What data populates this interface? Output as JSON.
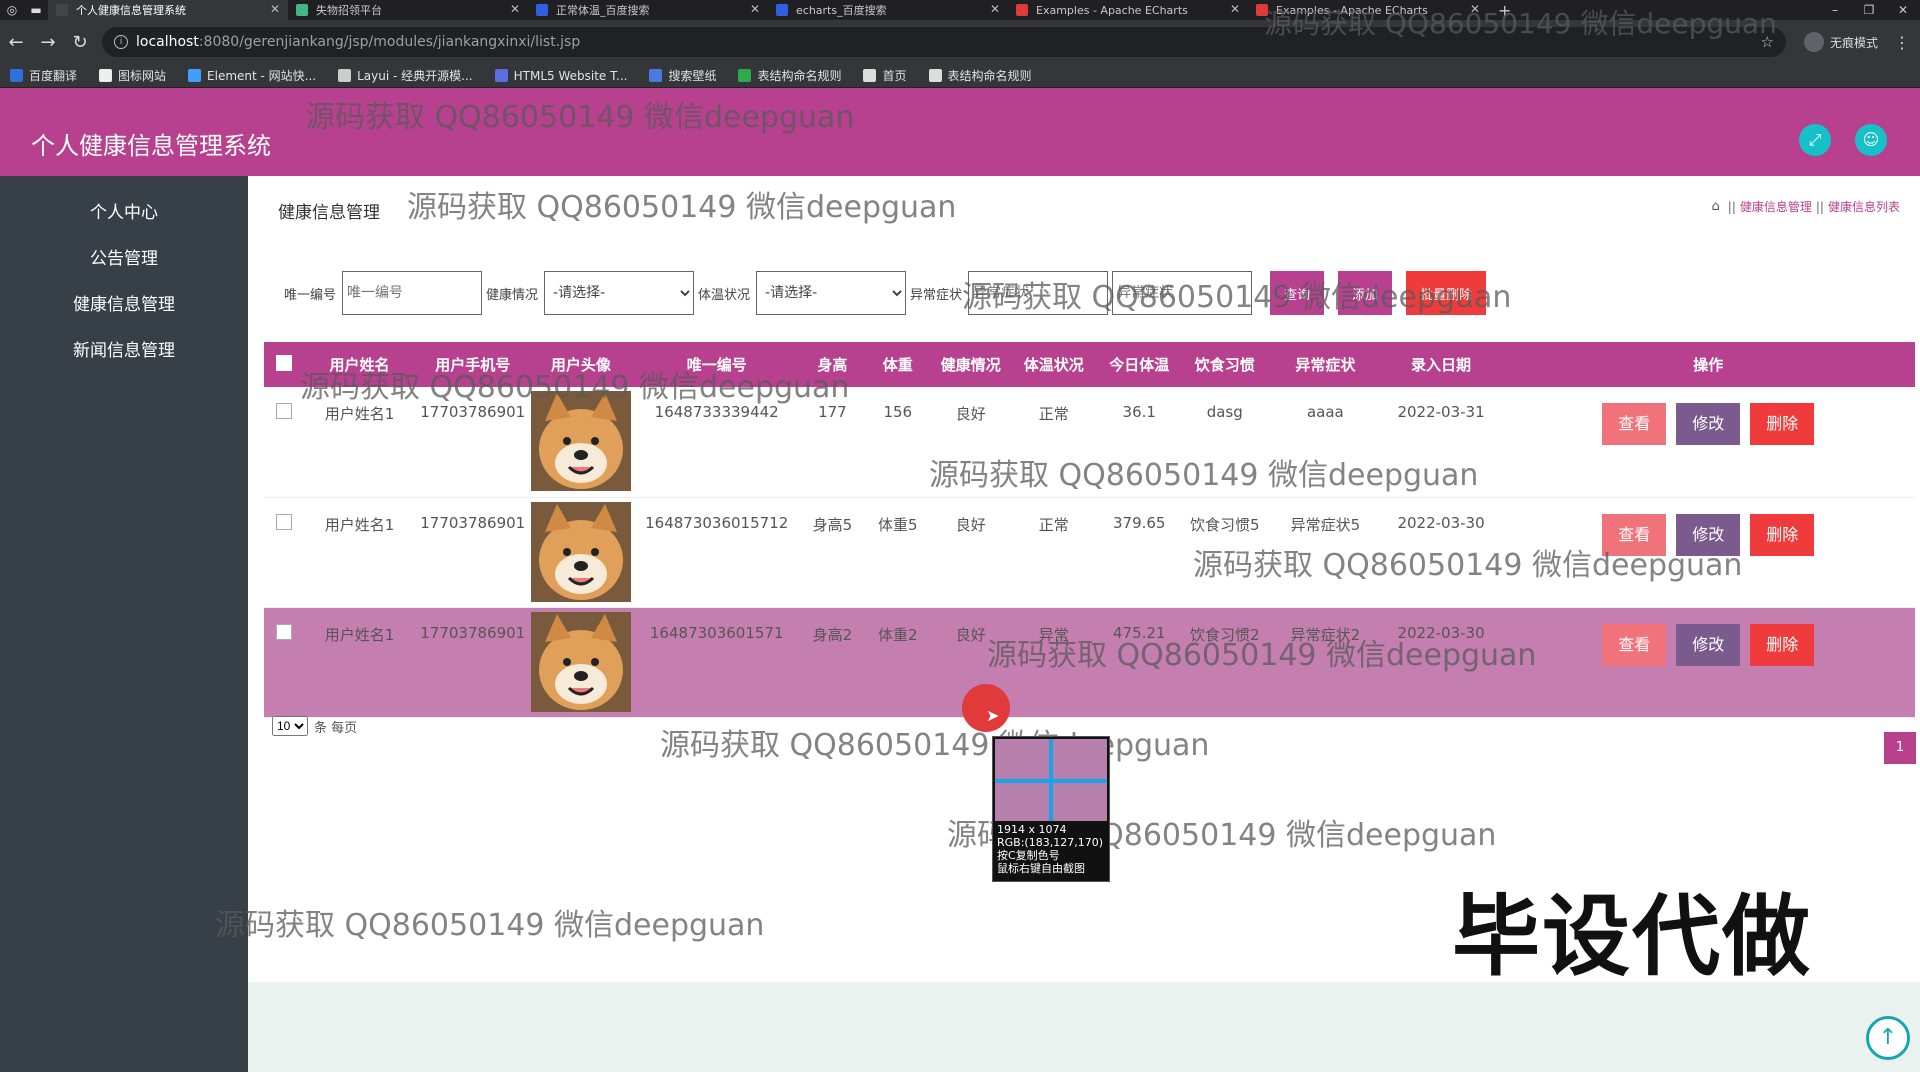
{
  "browser": {
    "tabs": [
      {
        "label": "个人健康信息管理系统",
        "active": true,
        "favicon_color": "#444"
      },
      {
        "label": "失物招领平台",
        "active": false,
        "favicon_color": "#41b883"
      },
      {
        "label": "正常体温_百度搜索",
        "active": false,
        "favicon_color": "#3060e0"
      },
      {
        "label": "echarts_百度搜索",
        "active": false,
        "favicon_color": "#3060e0"
      },
      {
        "label": "Examples - Apache ECharts",
        "active": false,
        "favicon_color": "#e03a3a"
      },
      {
        "label": "Examples - Apache ECharts",
        "active": false,
        "favicon_color": "#e03a3a"
      }
    ],
    "url_host": "localhost",
    "url_path": ":8080/gerenjiankang/jsp/modules/jiankangxinxi/list.jsp",
    "incognito_label": "无痕模式",
    "bookmarks": [
      {
        "label": "百度翻译",
        "color": "#2f6fe0"
      },
      {
        "label": "图标网站",
        "color": "#eeeeee"
      },
      {
        "label": "Element - 网站快...",
        "color": "#409eff"
      },
      {
        "label": "Layui - 经典开源模...",
        "color": "#cccccc"
      },
      {
        "label": "HTML5 Website T...",
        "color": "#5a6ee0"
      },
      {
        "label": "搜索壁纸",
        "color": "#4a7ae0"
      },
      {
        "label": "表结构命名规则",
        "color": "#2fa84f"
      },
      {
        "label": "首页",
        "color": "#dddddd"
      },
      {
        "label": "表结构命名规则",
        "color": "#dddddd"
      }
    ]
  },
  "app": {
    "title": "个人健康信息管理系统",
    "accent": "#b8418f"
  },
  "sidebar": {
    "items": [
      "个人中心",
      "公告管理",
      "健康信息管理",
      "新闻信息管理"
    ]
  },
  "page": {
    "heading": "健康信息管理",
    "breadcrumb": [
      "健康信息管理",
      "健康信息列表"
    ],
    "breadcrumb_sep": "||"
  },
  "search": {
    "id_label": "唯一编号",
    "id_placeholder": "唯一编号",
    "health_label": "健康情况",
    "health_value": "-请选择-",
    "temp_label": "体温状况",
    "temp_value": "-请选择-",
    "symptom_label": "异常症状",
    "symptom_placeholder": "异常症状",
    "extra_placeholder": "异常症状",
    "search_btn": "查询",
    "add_btn": "添加",
    "batch_delete_btn": "批量删除"
  },
  "table": {
    "headers": [
      "用户姓名",
      "用户手机号",
      "用户头像",
      "唯一编号",
      "身高",
      "体重",
      "健康情况",
      "体温状况",
      "今日体温",
      "饮食习惯",
      "异常症状",
      "录入日期",
      "操作"
    ],
    "rows": [
      {
        "name": "用户姓名1",
        "phone": "17703786901",
        "code": "1648733339442",
        "height": "177",
        "weight": "156",
        "health": "良好",
        "temp_status": "正常",
        "temp": "36.1",
        "diet": "dasg",
        "symptom": "aaaa",
        "date": "2022-03-31"
      },
      {
        "name": "用户姓名1",
        "phone": "17703786901",
        "code": "164873036015712",
        "height": "身高5",
        "weight": "体重5",
        "health": "良好",
        "temp_status": "正常",
        "temp": "379.65",
        "diet": "饮食习惯5",
        "symptom": "异常症状5",
        "date": "2022-03-30"
      },
      {
        "name": "用户姓名1",
        "phone": "17703786901",
        "code": "16487303601571",
        "height": "身高2",
        "weight": "体重2",
        "health": "良好",
        "temp_status": "异常",
        "temp": "475.21",
        "diet": "饮食习惯2",
        "symptom": "异常症状2",
        "date": "2022-03-30"
      }
    ],
    "view_btn": "查看",
    "edit_btn": "修改",
    "delete_btn": "删除"
  },
  "pager": {
    "page_size": "10",
    "page_size_suffix": "条 每页",
    "current_page": "1"
  },
  "overlays": {
    "watermark": "源码获取 QQ86050149 微信deepguan",
    "promo": "毕设代做",
    "picker_lines": [
      "1914 x 1074",
      "RGB:(183,127,170)",
      "按C复制色号",
      "鼠标右键自由截图"
    ]
  }
}
